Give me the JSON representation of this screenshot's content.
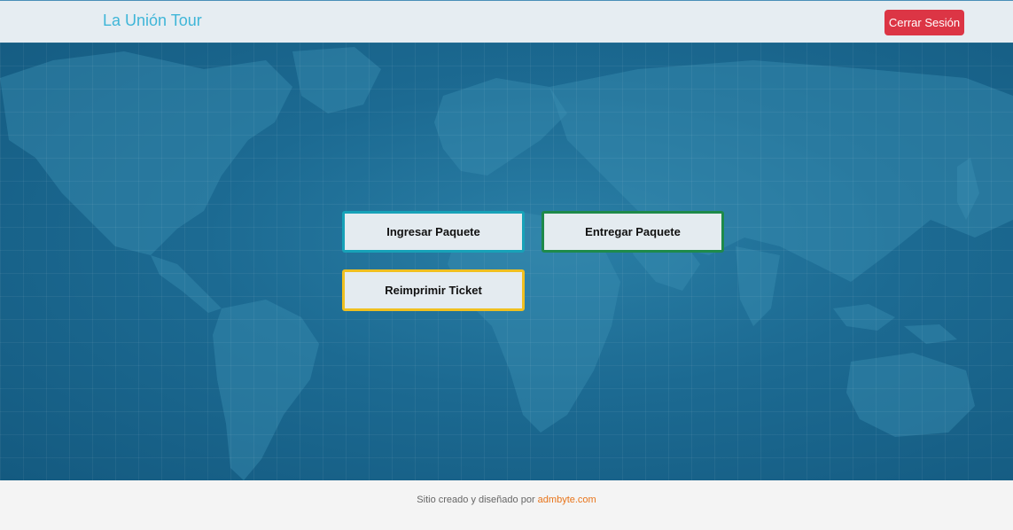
{
  "navbar": {
    "brand": "La Unión Tour",
    "logout_label": "Cerrar Sesión"
  },
  "actions": {
    "ingresar": "Ingresar Paquete",
    "entregar": "Entregar Paquete",
    "reimprimir": "Reimprimir Ticket"
  },
  "footer": {
    "text": "Sitio creado y diseñado por",
    "link": "admbyte.com"
  },
  "colors": {
    "brand": "#3fb6d8",
    "logout": "#dc3545",
    "ingresar_border": "#17a2b8",
    "entregar_border": "#1e8a4a",
    "reimprimir_border": "#f0c020",
    "footer_link": "#e8741a",
    "map_bg": "#1c6a92"
  }
}
